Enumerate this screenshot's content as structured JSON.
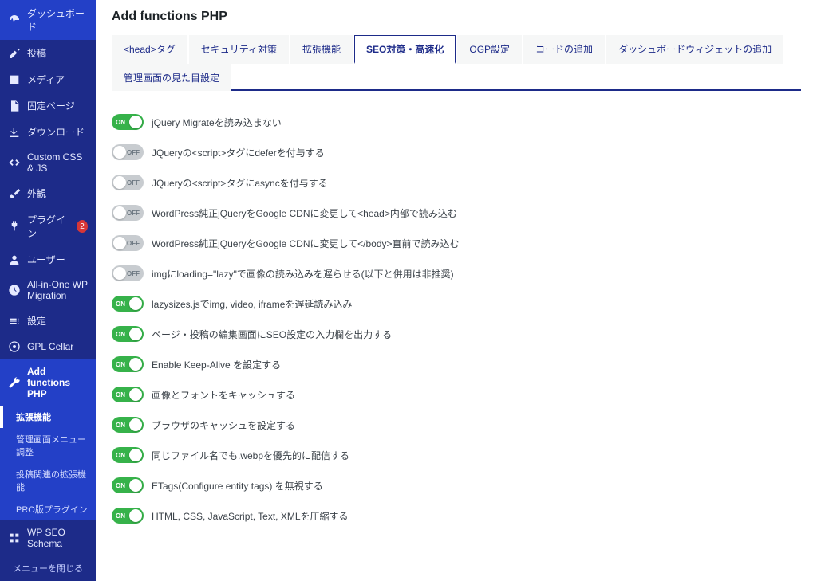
{
  "sidebar": {
    "items": [
      {
        "icon": "dashboard",
        "label": "ダッシュボード"
      },
      {
        "icon": "edit",
        "label": "投稿"
      },
      {
        "icon": "media",
        "label": "メディア"
      },
      {
        "icon": "page",
        "label": "固定ページ"
      },
      {
        "icon": "download",
        "label": "ダウンロード"
      },
      {
        "icon": "code",
        "label": "Custom CSS & JS"
      },
      {
        "icon": "brush",
        "label": "外観"
      },
      {
        "icon": "plugin",
        "label": "プラグイン",
        "badge": "2"
      },
      {
        "icon": "user",
        "label": "ユーザー"
      },
      {
        "icon": "migrate",
        "label": "All-in-One WP Migration"
      },
      {
        "icon": "settings",
        "label": "設定"
      },
      {
        "icon": "gpl",
        "label": "GPL Cellar"
      },
      {
        "icon": "wrench",
        "label": "Add functions PHP",
        "current": true
      },
      {
        "icon": "schema",
        "label": "WP SEO Schema"
      }
    ],
    "submenu": [
      {
        "label": "拡張機能",
        "active": true
      },
      {
        "label": "管理画面メニュー調整"
      },
      {
        "label": "投稿関連の拡張機能"
      },
      {
        "label": "PRO版プラグイン"
      }
    ],
    "collapse": "メニューを閉じる"
  },
  "header": {
    "title": "Add functions PHP"
  },
  "tabs": [
    {
      "label": "<head>タグ"
    },
    {
      "label": "セキュリティ対策"
    },
    {
      "label": "拡張機能"
    },
    {
      "label": "SEO対策・高速化",
      "active": true
    },
    {
      "label": "OGP設定"
    },
    {
      "label": "コードの追加"
    },
    {
      "label": "ダッシュボードウィジェットの追加"
    },
    {
      "label": "管理画面の見た目設定"
    }
  ],
  "toggle_text": {
    "on": "ON",
    "off": "OFF"
  },
  "settings": [
    {
      "on": true,
      "label": "jQuery Migrateを読み込まない"
    },
    {
      "on": false,
      "label": "JQueryの<script>タグにdeferを付与する"
    },
    {
      "on": false,
      "label": "JQueryの<script>タグにasyncを付与する"
    },
    {
      "on": false,
      "label": "WordPress純正jQueryをGoogle CDNに変更して<head>内部で読み込む"
    },
    {
      "on": false,
      "label": "WordPress純正jQueryをGoogle CDNに変更して</body>直前で読み込む"
    },
    {
      "on": false,
      "label": "imgにloading=\"lazy\"で画像の読み込みを遅らせる(以下と併用は非推奨)"
    },
    {
      "on": true,
      "label": "lazysizes.jsでimg, video, iframeを遅延読み込み"
    },
    {
      "on": true,
      "label": "ページ・投稿の編集画面にSEO設定の入力欄を出力する"
    },
    {
      "on": true,
      "label": "Enable Keep-Alive を設定する"
    },
    {
      "on": true,
      "label": "画像とフォントをキャッシュする"
    },
    {
      "on": true,
      "label": "ブラウザのキャッシュを設定する"
    },
    {
      "on": true,
      "label": "同じファイル名でも.webpを優先的に配信する"
    },
    {
      "on": true,
      "label": "ETags(Configure entity tags) を無視する"
    },
    {
      "on": true,
      "label": "HTML, CSS, JavaScript, Text, XMLを圧縮する"
    }
  ]
}
